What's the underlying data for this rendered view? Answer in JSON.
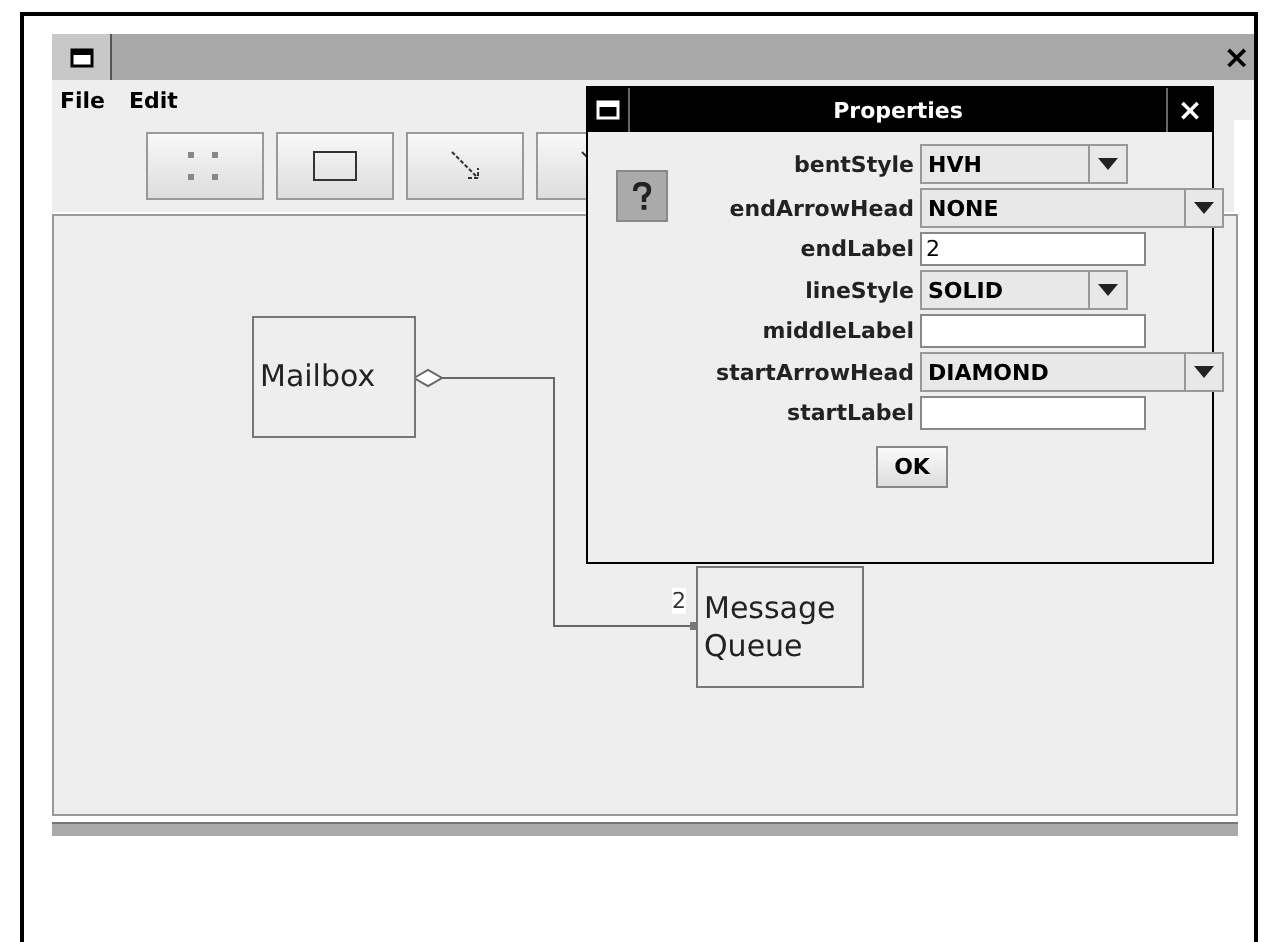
{
  "window": {
    "close": "×"
  },
  "menu": [
    "File",
    "Edit"
  ],
  "toolbar": [
    {
      "kind": "grabber"
    },
    {
      "kind": "node"
    },
    {
      "kind": "edge"
    },
    {
      "kind": "line"
    }
  ],
  "diagram": {
    "nodes": [
      {
        "lines": [
          "Mailbox"
        ]
      },
      {
        "lines": [
          "Message",
          "Queue"
        ]
      }
    ],
    "edge": {
      "start_head": {
        "kind": "diamond"
      },
      "end_label": "2"
    }
  },
  "dialog": {
    "title": "Properties",
    "close": "×",
    "properties": [
      {
        "label": "bentStyle",
        "kind": "combo",
        "value": "HVH",
        "wide": false
      },
      {
        "label": "endArrowHead",
        "kind": "combo",
        "value": "NONE",
        "wide": true
      },
      {
        "label": "endLabel",
        "kind": "text",
        "value": "2"
      },
      {
        "label": "lineStyle",
        "kind": "combo",
        "value": "SOLID",
        "wide": false
      },
      {
        "label": "middleLabel",
        "kind": "text"
      },
      {
        "label": "startArrowHead",
        "kind": "combo",
        "value": "DIAMOND",
        "wide": true
      },
      {
        "label": "startLabel",
        "kind": "text"
      }
    ],
    "ok": "OK"
  }
}
